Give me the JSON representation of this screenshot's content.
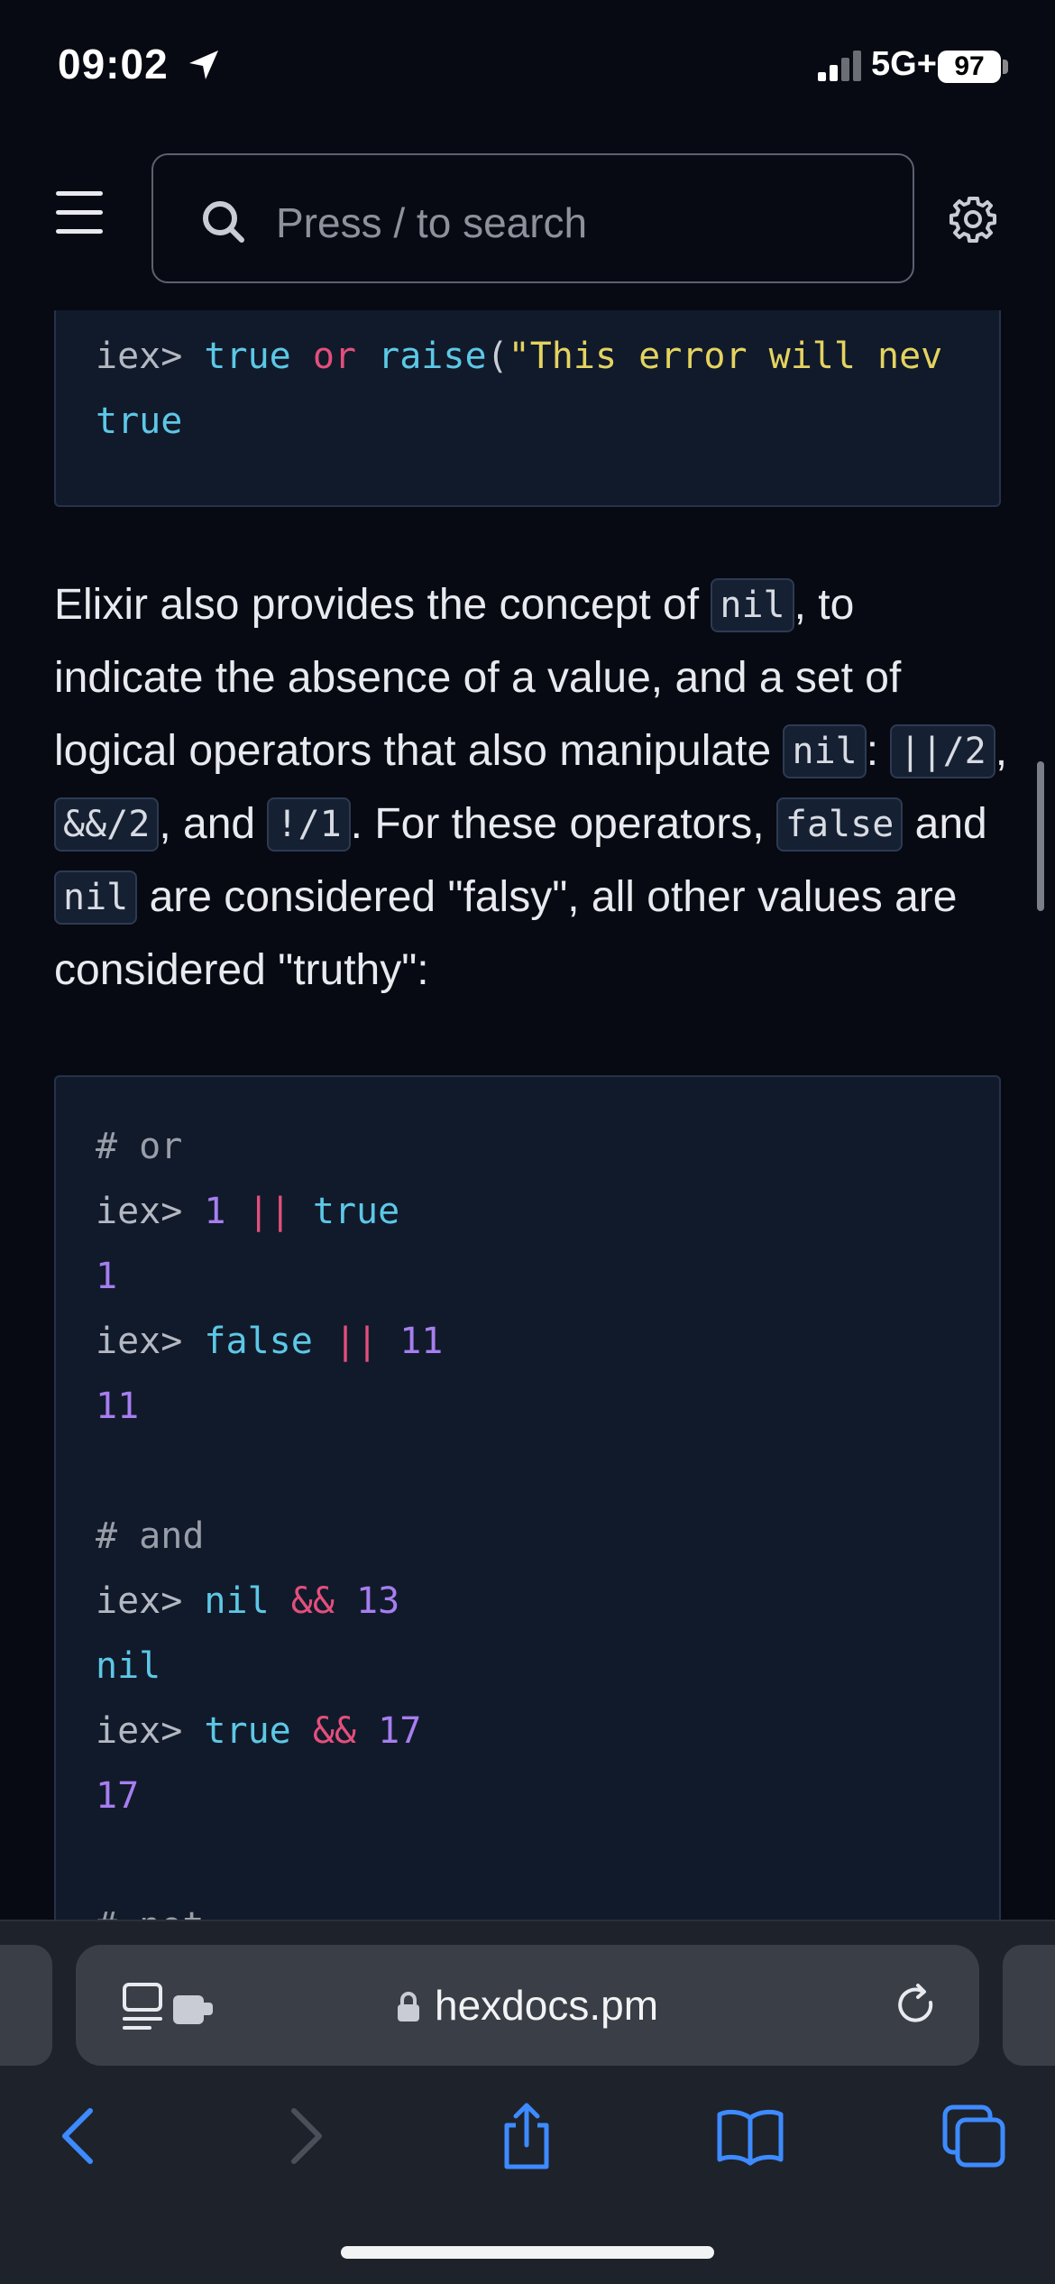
{
  "status_bar": {
    "time": "09:02",
    "network": "5G+",
    "battery": "97"
  },
  "docs_header": {
    "search_placeholder": "Press / to search"
  },
  "code_block_1": {
    "partial_top": "raise",
    "line1": {
      "prompt": "iex>",
      "v1": "true",
      "op": "or",
      "fn": "raise",
      "paren": "(",
      "str": "\"This error will nev"
    },
    "line2": "true"
  },
  "prose": {
    "t1": "Elixir also provides the concept of ",
    "c1": "nil",
    "t2": ", to indicate the absence of a value, and a set of logical operators that also manipulate ",
    "c2": "nil",
    "t3": ": ",
    "c3": "||/2",
    "t4": ", ",
    "c4": "&&/2",
    "t5": ", and ",
    "c5": "!/1",
    "t6": ". For these operators, ",
    "c6": "false",
    "t7": " and ",
    "c7": "nil",
    "t8": " are considered \"falsy\", all other values are considered \"truthy\":"
  },
  "code_block_2": {
    "comment_or": "# or",
    "l1": {
      "prompt": "iex>",
      "a": "1",
      "op": "||",
      "b": "true"
    },
    "r1": "1",
    "l2": {
      "prompt": "iex>",
      "a": "false",
      "op": "||",
      "b": "11"
    },
    "r2": "11",
    "comment_and": "# and",
    "l3": {
      "prompt": "iex>",
      "a": "nil",
      "op": "&&",
      "b": "13"
    },
    "r3": "nil",
    "l4": {
      "prompt": "iex>",
      "a": "true",
      "op": "&&",
      "b": "17"
    },
    "r4": "17",
    "partial_bottom": "# not"
  },
  "browser": {
    "url": "hexdocs.pm"
  },
  "icons": {
    "location": "location-arrow-icon",
    "menu": "hamburger-menu-icon",
    "search": "search-icon",
    "settings": "gear-icon",
    "page_menu": "page-menu-icon",
    "lock": "lock-icon",
    "reload": "reload-icon",
    "back": "back-chevron-icon",
    "forward": "forward-chevron-icon",
    "share": "share-icon",
    "bookmarks": "book-icon",
    "tabs": "tabs-icon"
  },
  "colors": {
    "background": "#070a12",
    "code_background": "#111a2b",
    "accent_blue": "#3d8bff",
    "string": "#e4d35f",
    "operator": "#e34f7c",
    "number": "#a77ef0",
    "atom": "#5cc8e6"
  }
}
